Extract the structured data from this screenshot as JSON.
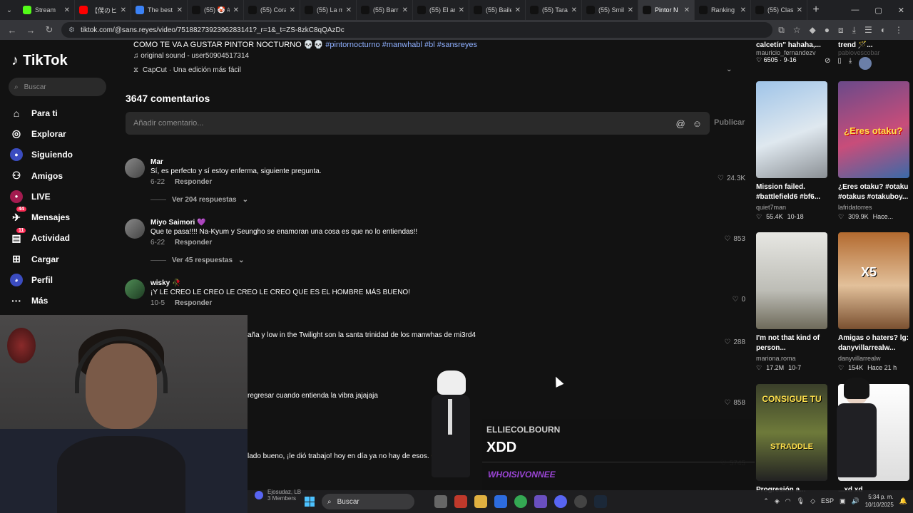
{
  "browser": {
    "tabs": [
      {
        "title": "Stream",
        "icon": "kick-icon",
        "color": "#53fc18"
      },
      {
        "title": "【僕のヒー",
        "icon": "youtube-icon",
        "color": "#ff0000"
      },
      {
        "title": "The best",
        "icon": "site-icon",
        "color": "#3b82f6"
      },
      {
        "title": "(55) 🤡 #",
        "icon": "tiktok-icon",
        "color": "#111111"
      },
      {
        "title": "(55) Cora",
        "icon": "tiktok-icon",
        "color": "#111111"
      },
      {
        "title": "(55) La m",
        "icon": "tiktok-icon",
        "color": "#111111"
      },
      {
        "title": "(55) Barri",
        "icon": "tiktok-icon",
        "color": "#111111"
      },
      {
        "title": "(55) El ar",
        "icon": "tiktok-icon",
        "color": "#111111"
      },
      {
        "title": "(55) Baile",
        "icon": "tiktok-icon",
        "color": "#111111"
      },
      {
        "title": "(55) Tara",
        "icon": "tiktok-icon",
        "color": "#111111"
      },
      {
        "title": "(55) Smil",
        "icon": "tiktok-icon",
        "color": "#111111"
      },
      {
        "title": "Pintor N",
        "icon": "tiktok-icon",
        "color": "#111111",
        "active": true
      },
      {
        "title": "Ranking",
        "icon": "tiktok-icon",
        "color": "#111111"
      },
      {
        "title": "(55) Clas",
        "icon": "tiktok-icon",
        "color": "#111111"
      }
    ],
    "url": "tiktok.com/@sans.reyes/video/7518827392396283141?_r=1&_t=ZS-8zkC8qQAzDc"
  },
  "sidebar": {
    "logo": "TikTok",
    "search_placeholder": "Buscar",
    "items": [
      {
        "label": "Para ti",
        "icon": "home-icon"
      },
      {
        "label": "Explorar",
        "icon": "compass-icon"
      },
      {
        "label": "Siguiendo",
        "icon": "following-avatar-icon"
      },
      {
        "label": "Amigos",
        "icon": "friends-icon"
      },
      {
        "label": "LIVE",
        "icon": "live-icon"
      },
      {
        "label": "Mensajes",
        "icon": "messages-icon",
        "badge": "44"
      },
      {
        "label": "Actividad",
        "icon": "activity-icon",
        "badge": "11"
      },
      {
        "label": "Cargar",
        "icon": "upload-icon"
      },
      {
        "label": "Perfil",
        "icon": "profile-icon"
      },
      {
        "label": "Más",
        "icon": "more-icon"
      }
    ]
  },
  "video": {
    "description": "COMO TE VA A GUSTAR PINTOR NOCTURNO 💀💀",
    "hashtags": "#pintornocturno #manwhabl #bl #sansreyes",
    "sound": "♫ original sound - user50904517314",
    "capcut": "CapCut · Una edición más fácil"
  },
  "comments_header": {
    "count": "3647 comentarios",
    "placeholder": "Añadir comentario...",
    "publish": "Publicar"
  },
  "comments": [
    {
      "name": "Mar",
      "text": "Sí, es perfecto y sí estoy enferma, siguiente pregunta.",
      "date": "6-22",
      "reply": "Responder",
      "likes": "24.3K",
      "view_replies": "Ver 204 respuestas"
    },
    {
      "name": "Miyo Saimori 💜",
      "text": "Que te pasa!!!! Na-Kyum y Seungho se enamoran una cosa es que no lo entiendas!!",
      "date": "6-22",
      "reply": "Responder",
      "likes": "853",
      "view_replies": "Ver 45 respuestas"
    },
    {
      "name": "wisky 🥀",
      "text": "¡Y LE CREO LE CREO LE CREO LE CREO QUE ES EL HOMBRE MÁS BUENO!",
      "date": "10-5",
      "reply": "Responder",
      "likes": "0",
      "view_replies": ""
    },
    {
      "name": "",
      "text": "aña y low in the Twilight son la santa trinidad de los manwhas de mi3rd4",
      "date": "",
      "reply": "",
      "likes": "288",
      "view_replies": ""
    },
    {
      "name": "",
      "text": "regresar cuando entienda la vibra jajajaja",
      "date": "",
      "reply": "",
      "likes": "858",
      "view_replies": ""
    },
    {
      "name": "",
      "text": "lado bueno, ¡le dió trabajo! hoy en día ya no hay de esos. 😊",
      "date": "",
      "reply": "",
      "likes": "5745",
      "view_replies": ""
    }
  ],
  "recommended_top": [
    {
      "title": "calcetín\" hahaha,...",
      "user": "mauricio_fernandezv",
      "stats": "♡ 6505 · 9-16"
    },
    {
      "title": "trend 🪄...",
      "user": "pablovescobar",
      "stats": ""
    }
  ],
  "recommended": [
    {
      "title": "Mission failed. #battlefield6 #bf6...",
      "user": "quiet7man",
      "likes": "55.4K",
      "date": "10-18"
    },
    {
      "title": "¿Eres otaku? #otaku #otakus #otakuboy...",
      "user": "lafridatorres",
      "likes": "309.9K",
      "date": "Hace..."
    },
    {
      "title": "I'm not that kind of person...",
      "user": "mariona.roma",
      "likes": "17.2M",
      "date": "10-7"
    },
    {
      "title": "Amigas o haters? lg: danyvillarrealw...",
      "user": "danyvillarrealw",
      "likes": "154K",
      "date": "Hace 21 h"
    },
    {
      "title": "Progresión a...",
      "user": "",
      "likes": "",
      "date": ""
    },
    {
      "title": "...xd xd",
      "user": "",
      "likes": "",
      "date": ""
    }
  ],
  "thumb_text": {
    "otaku": "¿Eres otaku?",
    "x5": "X5",
    "consigue": "CONSIGUE TU",
    "straddle": "STRADDLE"
  },
  "stream_chat": {
    "user1": "ELLIECOLBOURN",
    "msg1": "XDD",
    "user2": "WHOISIVONNEE"
  },
  "taskbar": {
    "discord_name": "Ejosudaz, LB",
    "discord_members": "3 Members",
    "search": "Buscar",
    "lang": "ESP",
    "time": "5:34 p. m.",
    "date": "10/10/2025"
  }
}
